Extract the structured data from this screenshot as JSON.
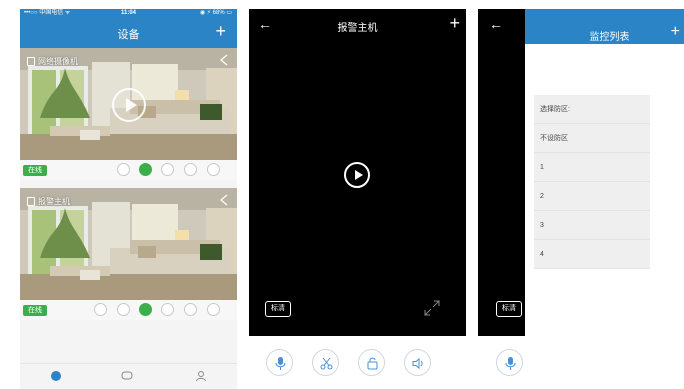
{
  "panel1": {
    "status": {
      "carrier": "•••○○ 中国电信 ᯤ",
      "time": "11:04",
      "battery": "◉ ⚡ 68% ▭"
    },
    "nav": {
      "title": "设备",
      "plus": "+"
    },
    "cards": [
      {
        "label": "网络摄像机",
        "online": "在线"
      },
      {
        "label": "报警主机",
        "online": "在线"
      }
    ],
    "tabs": [
      "home-icon",
      "message-icon",
      "profile-icon"
    ],
    "colors": {
      "brand": "#2b84c6",
      "online": "#3cae4a"
    }
  },
  "panel2": {
    "back": "←",
    "title": "报警主机",
    "plus": "+",
    "quality": "标清",
    "controls": [
      "microphone-icon",
      "scissors-icon",
      "unlock-icon",
      "speaker-icon"
    ]
  },
  "panel3": {
    "back": "←",
    "quality": "标清",
    "title": "监控列表",
    "plus": "+",
    "zones": [
      "选择防区:",
      "不设防区",
      "1",
      "2",
      "3",
      "4"
    ]
  }
}
